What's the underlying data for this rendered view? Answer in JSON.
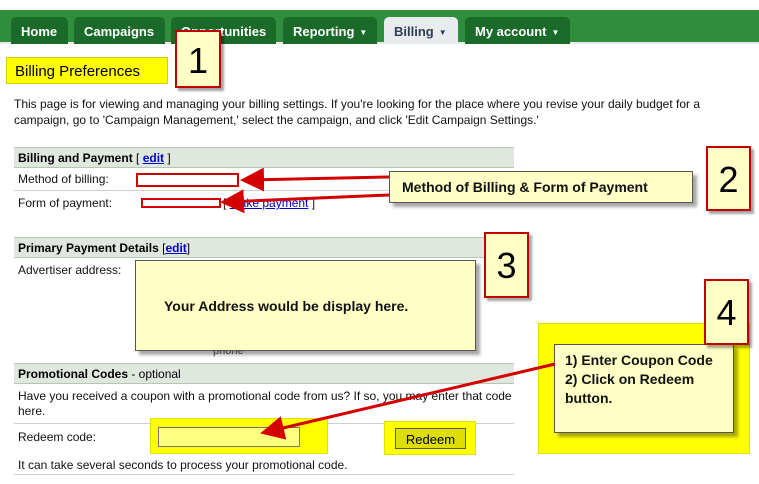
{
  "nav": {
    "tabs": [
      {
        "label": "Home",
        "has_menu": false,
        "active": false
      },
      {
        "label": "Campaigns",
        "has_menu": false,
        "active": false
      },
      {
        "label": "Opportunities",
        "has_menu": false,
        "active": false
      },
      {
        "label": "Reporting",
        "has_menu": true,
        "active": false
      },
      {
        "label": "Billing",
        "has_menu": true,
        "active": true
      },
      {
        "label": "My account",
        "has_menu": true,
        "active": false
      }
    ]
  },
  "page": {
    "title": "Billing Preferences",
    "intro": "This page is for viewing and managing your billing settings. If you're looking for the place where you revise your daily budget for a campaign, go to 'Campaign Management,' select the campaign, and click 'Edit Campaign Settings.'"
  },
  "billing_payment": {
    "heading": "Billing and Payment",
    "edit_link": "edit",
    "method_label": "Method of billing:",
    "form_label": "Form of payment:",
    "make_payment_link": "Make payment"
  },
  "primary_payment": {
    "heading": "Primary Payment Details",
    "edit_link": "edit",
    "address_label": "Advertiser address:",
    "phone_fragment": "phone"
  },
  "promo": {
    "heading": "Promotional Codes",
    "heading_suffix": " - optional",
    "question": "Have you received a coupon with a promotional code from us? If so, you may enter that code here.",
    "redeem_label": "Redeem code:",
    "redeem_value": "",
    "redeem_button": "Redeem",
    "note": "It can take several seconds to process your promotional code."
  },
  "callouts": {
    "c1_number": "1",
    "c2_number": "2",
    "c2_text": "Method of Billing & Form of Payment",
    "c3_number": "3",
    "c3_text": "Your Address would be display here.",
    "c4_number": "4",
    "c4_text": "1) Enter Coupon Code 2) Click on Redeem button."
  },
  "colors": {
    "nav_green": "#2f8e3b",
    "tab_dark": "#1a6b2a",
    "highlight_yellow": "#ffff00",
    "callout_fill": "#ffffc6",
    "arrow_red": "#d40000"
  }
}
